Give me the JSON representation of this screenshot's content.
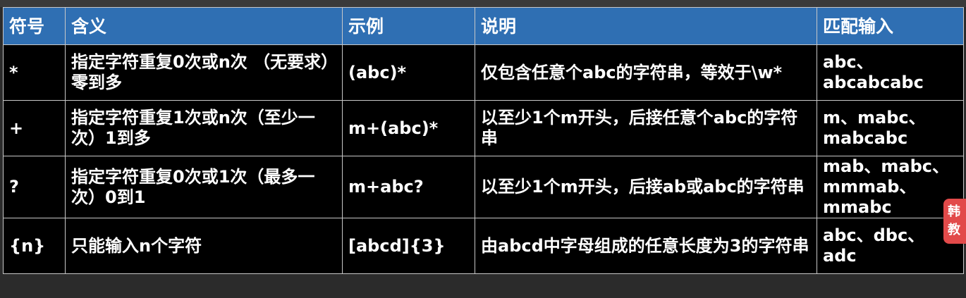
{
  "table": {
    "headers": [
      "符号",
      "含义",
      "示例",
      "说明",
      "匹配输入"
    ],
    "rows": [
      {
        "symbol": "*",
        "meaning": "指定字符重复0次或n次 （无要求）零到多",
        "example": "(abc)*",
        "description": "仅包含任意个abc的字符串，等效于\\w*",
        "matches": "abc、abcabcabc"
      },
      {
        "symbol": "+",
        "meaning": "指定字符重复1次或n次（至少一次）1到多",
        "example": "m+(abc)*",
        "description": "以至少1个m开头，后接任意个abc的字符串",
        "matches": "m、mabc、mabcabc"
      },
      {
        "symbol": "?",
        "meaning": "指定字符重复0次或1次（最多一次）0到1",
        "example": "m+abc?",
        "description": "以至少1个m开头，后接ab或abc的字符串",
        "matches": "mab、mabc、mmmab、mmabc"
      },
      {
        "symbol": "{n}",
        "meaning": "只能输入n个字符",
        "example": "[abcd]{3}",
        "description": "由abcd中字母组成的任意长度为3的字符串",
        "matches": "abc、dbc、adc"
      }
    ]
  },
  "side_badge": {
    "line1": "韩",
    "line2": "教"
  }
}
